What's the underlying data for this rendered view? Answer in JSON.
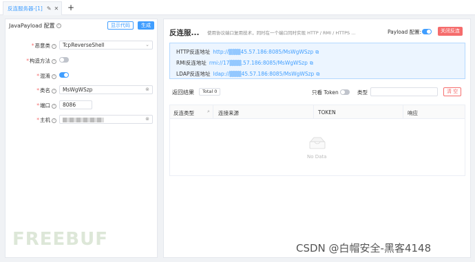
{
  "tabs": [
    {
      "label": "反连服务器-[1]"
    }
  ],
  "tab_add": "+",
  "left": {
    "header": "JavaPayload 配置",
    "show_code": "显示代码",
    "generate": "生成",
    "fields": {
      "malicious_class": {
        "label": "恶意类",
        "value": "TcpReverseShell"
      },
      "construct_method": {
        "label": "构造方法",
        "enabled": false
      },
      "obfuscate": {
        "label": "混淆",
        "enabled": true
      },
      "class_name": {
        "label": "类名",
        "value": "MsWgWSzp"
      },
      "port": {
        "label": "端口",
        "value": "8086"
      },
      "host": {
        "label": "主机"
      }
    }
  },
  "right": {
    "title": "反连服...",
    "description": "使用协议端口复用技术，同时在一个端口同时实现 HTTP / RMI / HTTPS ...",
    "payload_label": "Payload 配置:",
    "close_button": "关闭反连",
    "addresses": [
      {
        "label": "HTTP反连地址",
        "value": "http://▒▒▒45.57.186:8085/MsWgWSzp"
      },
      {
        "label": "RMI反连地址",
        "value": "rmi://17▒▒▒.57.186:8085/MsWgWSzp"
      },
      {
        "label": "LDAP反连地址",
        "value": "ldap://▒▒▒45.57.186:8085/MsWgWSzp"
      }
    ],
    "results_label": "返回结果",
    "total": "Total 0",
    "token_only_label": "只看 Token",
    "type_label": "类型",
    "clear_button": "清 空",
    "columns": [
      "反连类型",
      "连接来源",
      "TOKEN",
      "响应"
    ],
    "empty_text": "No Data"
  },
  "watermark": {
    "logo": "FREEBUF",
    "csdn": "CSDN @白帽安全-黑客4148"
  },
  "colors": {
    "primary": "#409eff",
    "danger": "#f56c6c"
  }
}
